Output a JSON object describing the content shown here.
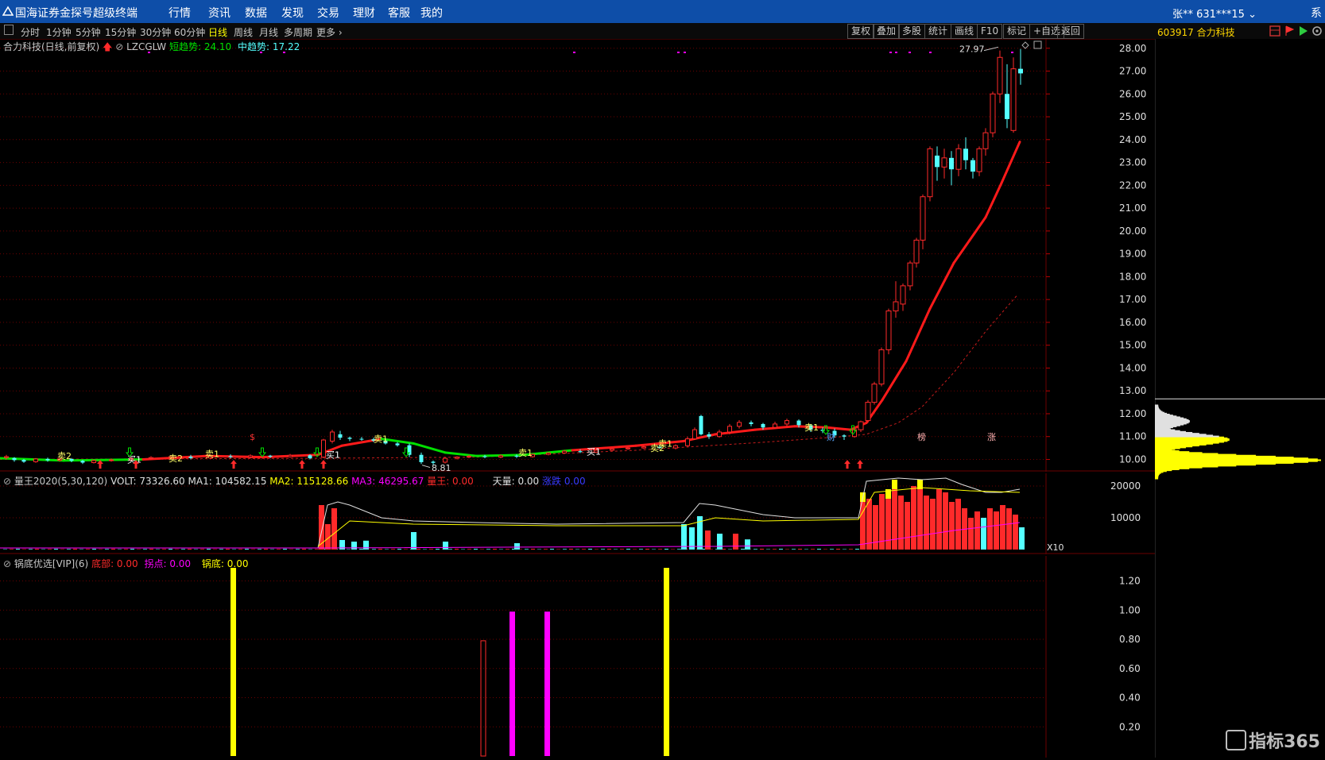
{
  "app": {
    "title": "国海证券金探号超级终端",
    "menu": [
      "行情",
      "资讯",
      "数据",
      "发现",
      "交易",
      "理财",
      "客服",
      "我的"
    ],
    "user": "张**  631***15",
    "sys": "系"
  },
  "toolbar": {
    "periods": [
      "分时",
      "1分钟",
      "5分钟",
      "15分钟",
      "30分钟",
      "60分钟",
      "日线",
      "周线",
      "月线",
      "多周期",
      "更多"
    ],
    "active": "日线",
    "right_buttons": [
      "复权",
      "叠加",
      "多股",
      "统计",
      "画线",
      "F10",
      "标记",
      "+自选",
      "返回"
    ]
  },
  "stock": {
    "code": "603917",
    "name": "合力科技",
    "title_line": "合力科技(日线,前复权)"
  },
  "main_legend": {
    "indicator": "LZCGLW",
    "short_trend_label": "短趋势",
    "short_trend_value": "24.10",
    "mid_trend_label": "中趋势",
    "mid_trend_value": "17.22"
  },
  "volume_legend": {
    "name": "量王2020(5,30,120)",
    "volt": "VOLT: 73326.60",
    "ma1": "MA1: 104582.15",
    "ma2": "MA2: 115128.66",
    "ma3": "MA3: 46295.67",
    "lw": "量王: 0.00",
    "tl": "天量: 0.00",
    "zd": "涨跌",
    "zd_value": "0.00"
  },
  "indicator_legend": {
    "name": "锅底优选[VIP](6)",
    "bottom": "底部: 0.00",
    "turn": "拐点: 0.00",
    "pot": "锅底: 0.00"
  },
  "annotations": {
    "high": "27.97",
    "low": "8.81",
    "signals": [
      "卖2",
      "买1",
      "卖2",
      "卖1",
      "买1",
      "卖1",
      "卖1",
      "买1",
      "卖2",
      "卖1",
      "卖1"
    ],
    "s_marker": "$",
    "events": [
      "财",
      "榜",
      "涨"
    ],
    "vol_scale": "X10"
  },
  "colors": {
    "up": "#ff2a2a",
    "down": "#54ffff",
    "yellow": "#ffff00",
    "magenta": "#ff00ff",
    "green_line": "#00e000",
    "ma_red": "#ff1a1a",
    "grid": "#6b0000"
  },
  "chart_data": [
    {
      "type": "candlestick",
      "title": "合力科技(日线,前复权)",
      "ylim": [
        9.6,
        28.2
      ],
      "yticks": [
        "28.00",
        "27.00",
        "26.00",
        "25.00",
        "24.00",
        "23.00",
        "22.00",
        "21.00",
        "20.00",
        "19.00",
        "18.00",
        "17.00",
        "16.00",
        "15.00",
        "14.00",
        "13.00",
        "12.00",
        "11.00",
        "10.00"
      ],
      "series": [
        {
          "name": "短趋势",
          "values": [
            [
              0,
              10.05
            ],
            [
              80,
              9.95
            ],
            [
              180,
              10.0
            ],
            [
              260,
              10.15
            ],
            [
              330,
              10.1
            ],
            [
              400,
              10.2
            ],
            [
              430,
              10.6
            ],
            [
              480,
              10.9
            ],
            [
              520,
              10.7
            ],
            [
              560,
              10.3
            ],
            [
              600,
              10.15
            ],
            [
              660,
              10.2
            ],
            [
              720,
              10.4
            ],
            [
              800,
              10.6
            ],
            [
              860,
              10.8
            ],
            [
              900,
              11.1
            ],
            [
              950,
              11.3
            ],
            [
              1000,
              11.45
            ],
            [
              1040,
              11.4
            ],
            [
              1070,
              11.3
            ],
            [
              1090,
              11.6
            ],
            [
              1110,
              12.6
            ],
            [
              1140,
              14.3
            ],
            [
              1170,
              16.6
            ],
            [
              1200,
              18.6
            ],
            [
              1220,
              19.6
            ],
            [
              1240,
              20.6
            ],
            [
              1260,
              22.1
            ],
            [
              1283,
              23.9
            ]
          ]
        },
        {
          "name": "中趋势",
          "values": [
            [
              0,
              10.0
            ],
            [
              400,
              10.05
            ],
            [
              600,
              10.1
            ],
            [
              800,
              10.4
            ],
            [
              960,
              10.75
            ],
            [
              1060,
              11.0
            ],
            [
              1090,
              11.1
            ],
            [
              1130,
              11.6
            ],
            [
              1160,
              12.3
            ],
            [
              1200,
              13.8
            ],
            [
              1240,
              15.6
            ],
            [
              1280,
              17.2
            ]
          ]
        }
      ],
      "candles": [
        [
          8,
          10.08,
          10.12,
          10.2,
          10.0
        ],
        [
          18,
          10.06,
          9.97,
          10.1,
          9.9
        ],
        [
          30,
          9.98,
          9.9,
          10.02,
          9.85
        ],
        [
          45,
          9.9,
          10.02,
          10.06,
          9.85
        ],
        [
          60,
          10.02,
          9.96,
          10.08,
          9.9
        ],
        [
          75,
          9.96,
          10.02,
          10.08,
          9.9
        ],
        [
          90,
          10.02,
          9.94,
          10.06,
          9.88
        ],
        [
          104,
          9.94,
          9.86,
          9.98,
          9.8
        ],
        [
          118,
          9.86,
          9.95,
          10.0,
          9.82
        ],
        [
          140,
          9.95,
          9.98,
          10.04,
          9.9
        ],
        [
          165,
          9.98,
          10.04,
          10.1,
          9.95
        ],
        [
          190,
          10.04,
          10.08,
          10.14,
          10.0
        ],
        [
          215,
          10.08,
          10.12,
          10.18,
          10.03
        ],
        [
          240,
          10.12,
          10.06,
          10.2,
          10.0
        ],
        [
          265,
          10.06,
          10.14,
          10.2,
          10.02
        ],
        [
          290,
          10.14,
          10.1,
          10.22,
          10.05
        ],
        [
          315,
          10.1,
          10.16,
          10.22,
          10.05
        ],
        [
          340,
          10.16,
          10.12,
          10.2,
          10.06
        ],
        [
          365,
          10.12,
          10.18,
          10.24,
          10.08
        ],
        [
          390,
          10.18,
          10.05,
          10.22,
          10.0
        ],
        [
          407,
          10.1,
          10.85,
          10.9,
          10.05
        ],
        [
          418,
          10.8,
          11.2,
          11.3,
          10.7
        ],
        [
          428,
          11.1,
          10.95,
          11.25,
          10.85
        ],
        [
          440,
          10.95,
          10.9,
          11.0,
          10.8
        ],
        [
          455,
          10.9,
          10.88,
          10.98,
          10.82
        ],
        [
          470,
          10.88,
          10.82,
          10.95,
          10.75
        ],
        [
          485,
          10.82,
          10.7,
          10.9,
          10.65
        ],
        [
          500,
          10.7,
          10.62,
          10.76,
          10.56
        ],
        [
          515,
          10.62,
          10.2,
          10.7,
          10.1
        ],
        [
          530,
          10.2,
          9.88,
          10.3,
          9.8
        ],
        [
          545,
          9.9,
          9.85,
          9.95,
          9.75
        ],
        [
          560,
          9.88,
          10.05,
          10.1,
          9.82
        ],
        [
          575,
          10.05,
          10.1,
          10.14,
          10.0
        ],
        [
          590,
          10.1,
          10.14,
          10.2,
          10.05
        ],
        [
          610,
          10.14,
          10.1,
          10.2,
          10.05
        ],
        [
          630,
          10.1,
          10.16,
          10.22,
          10.05
        ],
        [
          650,
          10.16,
          10.12,
          10.22,
          10.06
        ],
        [
          670,
          10.12,
          10.22,
          10.26,
          10.08
        ],
        [
          690,
          10.22,
          10.28,
          10.32,
          10.18
        ],
        [
          710,
          10.28,
          10.36,
          10.42,
          10.24
        ],
        [
          730,
          10.36,
          10.32,
          10.44,
          10.28
        ],
        [
          750,
          10.32,
          10.4,
          10.46,
          10.28
        ],
        [
          770,
          10.4,
          10.46,
          10.52,
          10.36
        ],
        [
          790,
          10.46,
          10.5,
          10.56,
          10.42
        ],
        [
          810,
          10.5,
          10.55,
          10.6,
          10.46
        ],
        [
          830,
          10.55,
          10.5,
          10.62,
          10.46
        ],
        [
          850,
          10.5,
          10.6,
          10.66,
          10.44
        ],
        [
          865,
          10.6,
          10.9,
          11.0,
          10.55
        ],
        [
          874,
          10.9,
          11.3,
          11.4,
          10.85
        ],
        [
          882,
          11.9,
          11.1,
          11.95,
          11.05
        ],
        [
          892,
          11.1,
          11.0,
          11.2,
          10.9
        ],
        [
          905,
          11.0,
          11.2,
          11.3,
          10.95
        ],
        [
          918,
          11.2,
          11.45,
          11.55,
          11.1
        ],
        [
          930,
          11.45,
          11.62,
          11.72,
          11.35
        ],
        [
          945,
          11.62,
          11.55,
          11.7,
          11.45
        ],
        [
          960,
          11.55,
          11.4,
          11.6,
          11.3
        ],
        [
          975,
          11.4,
          11.55,
          11.65,
          11.35
        ],
        [
          990,
          11.55,
          11.7,
          11.78,
          11.45
        ],
        [
          1005,
          11.7,
          11.5,
          11.75,
          11.4
        ],
        [
          1020,
          11.5,
          11.3,
          11.55,
          11.2
        ],
        [
          1035,
          11.3,
          11.25,
          11.4,
          11.15
        ],
        [
          1050,
          11.25,
          11.05,
          11.35,
          10.95
        ],
        [
          1062,
          11.05,
          11.0,
          11.1,
          10.85
        ],
        [
          1075,
          11.0,
          11.3,
          11.35,
          10.95
        ],
        [
          1083,
          11.3,
          11.65,
          11.7,
          11.2
        ],
        [
          1092,
          11.7,
          12.5,
          12.6,
          11.6
        ],
        [
          1100,
          12.5,
          13.3,
          13.4,
          12.4
        ],
        [
          1109,
          13.3,
          14.8,
          14.9,
          13.2
        ],
        [
          1118,
          14.8,
          16.5,
          16.6,
          14.6
        ],
        [
          1127,
          16.5,
          16.9,
          17.8,
          16.2
        ],
        [
          1136,
          16.8,
          17.6,
          17.7,
          16.5
        ],
        [
          1145,
          17.6,
          18.6,
          18.7,
          17.4
        ],
        [
          1153,
          18.6,
          19.6,
          19.7,
          18.4
        ],
        [
          1161,
          19.6,
          21.5,
          21.6,
          19.2
        ],
        [
          1170,
          21.5,
          23.6,
          23.7,
          21.3
        ],
        [
          1179,
          23.3,
          22.8,
          23.7,
          22.2
        ],
        [
          1188,
          22.8,
          23.2,
          23.6,
          22.3
        ],
        [
          1197,
          23.2,
          22.7,
          23.5,
          22.0
        ],
        [
          1206,
          22.7,
          23.6,
          23.8,
          22.4
        ],
        [
          1215,
          23.6,
          23.1,
          24.1,
          22.7
        ],
        [
          1224,
          23.1,
          22.6,
          23.2,
          22.3
        ],
        [
          1232,
          22.6,
          23.6,
          23.7,
          22.4
        ],
        [
          1240,
          23.6,
          24.3,
          24.5,
          23.3
        ],
        [
          1249,
          24.3,
          26.0,
          26.1,
          24.1
        ],
        [
          1258,
          26.0,
          27.6,
          27.9,
          25.6
        ],
        [
          1267,
          26.0,
          24.9,
          27.3,
          24.5
        ],
        [
          1275,
          24.4,
          27.1,
          27.6,
          24.3
        ],
        [
          1284,
          27.1,
          26.9,
          27.97,
          26.4
        ]
      ]
    },
    {
      "type": "bar",
      "title": "量王2020(5,30,120)",
      "ylim": [
        0,
        23000
      ],
      "yticks": [
        "20000",
        "10000"
      ],
      "values": [
        [
          404,
          1400,
          "red"
        ],
        [
          412,
          800,
          "red"
        ],
        [
          420,
          1300,
          "red"
        ],
        [
          430,
          300,
          "cyan"
        ],
        [
          445,
          250,
          "cyan"
        ],
        [
          460,
          280,
          "cyan"
        ],
        [
          520,
          550,
          "cyan"
        ],
        [
          560,
          250,
          "cyan"
        ],
        [
          650,
          200,
          "cyan"
        ],
        [
          860,
          800,
          "cyan"
        ],
        [
          870,
          700,
          "cyan"
        ],
        [
          880,
          1050,
          "cyan"
        ],
        [
          890,
          600,
          "red"
        ],
        [
          905,
          500,
          "cyan"
        ],
        [
          925,
          500,
          "red"
        ],
        [
          940,
          320,
          "cyan"
        ],
        [
          1085,
          1800,
          "yellow"
        ],
        [
          1093,
          1600,
          "red"
        ],
        [
          1101,
          1400,
          "red"
        ],
        [
          1109,
          1750,
          "red"
        ],
        [
          1117,
          1900,
          "yellow"
        ],
        [
          1125,
          2200,
          "yellow"
        ],
        [
          1133,
          1700,
          "red"
        ],
        [
          1141,
          1500,
          "red"
        ],
        [
          1149,
          2000,
          "red"
        ],
        [
          1157,
          2200,
          "yellow"
        ],
        [
          1165,
          1700,
          "red"
        ],
        [
          1173,
          1600,
          "red"
        ],
        [
          1181,
          1900,
          "red"
        ],
        [
          1189,
          1800,
          "red"
        ],
        [
          1197,
          1500,
          "red"
        ],
        [
          1205,
          1600,
          "red"
        ],
        [
          1213,
          1300,
          "red"
        ],
        [
          1221,
          1000,
          "red"
        ],
        [
          1229,
          1200,
          "red"
        ],
        [
          1237,
          1000,
          "cyan"
        ],
        [
          1245,
          1300,
          "red"
        ],
        [
          1253,
          1200,
          "red"
        ],
        [
          1261,
          1400,
          "red"
        ],
        [
          1269,
          1300,
          "red"
        ],
        [
          1277,
          1100,
          "red"
        ],
        [
          1285,
          700,
          "cyan"
        ]
      ]
    },
    {
      "type": "bar",
      "title": "锅底优选[VIP](6)",
      "ylim": [
        0,
        1.35
      ],
      "yticks": [
        "1.20",
        "1.00",
        "0.80",
        "0.60",
        "0.40",
        "0.20"
      ],
      "values": [
        [
          293,
          1.29,
          "yellow"
        ],
        [
          608,
          0.79,
          "hollow-red"
        ],
        [
          644,
          0.99,
          "magenta"
        ],
        [
          688,
          0.99,
          "magenta"
        ],
        [
          838,
          1.29,
          "yellow"
        ]
      ]
    }
  ]
}
